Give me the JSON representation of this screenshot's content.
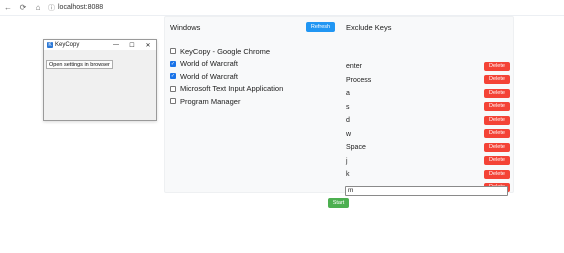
{
  "browser": {
    "address": "localhost:8088",
    "back_icon": "arrow-left-icon",
    "reload_icon": "reload-icon",
    "home_icon": "home-icon"
  },
  "keycopy_window": {
    "title": "KeyCopy",
    "logo_letter": "K",
    "minimize": "—",
    "maximize": "☐",
    "close": "✕",
    "open_settings_label": "Open settings in browser"
  },
  "windows": {
    "title": "Windows",
    "refresh_label": "Refresh",
    "items": [
      {
        "label": "KeyCopy - Google Chrome",
        "checked": false
      },
      {
        "label": "World of Warcraft",
        "checked": true
      },
      {
        "label": "World of Warcraft",
        "checked": true
      },
      {
        "label": "Microsoft Text Input Application",
        "checked": false
      },
      {
        "label": "Program Manager",
        "checked": false
      }
    ]
  },
  "exclude_keys": {
    "title": "Exclude Keys",
    "delete_label": "Delete",
    "keys": [
      "enter",
      "Process",
      "a",
      "s",
      "d",
      "w",
      "Space",
      "j",
      "k",
      "m"
    ],
    "input_value": "m"
  },
  "start_label": "Start",
  "colors": {
    "refresh": "#2196f3",
    "delete": "#f44336",
    "start": "#4caf50",
    "checkbox_checked": "#1a73e8"
  }
}
